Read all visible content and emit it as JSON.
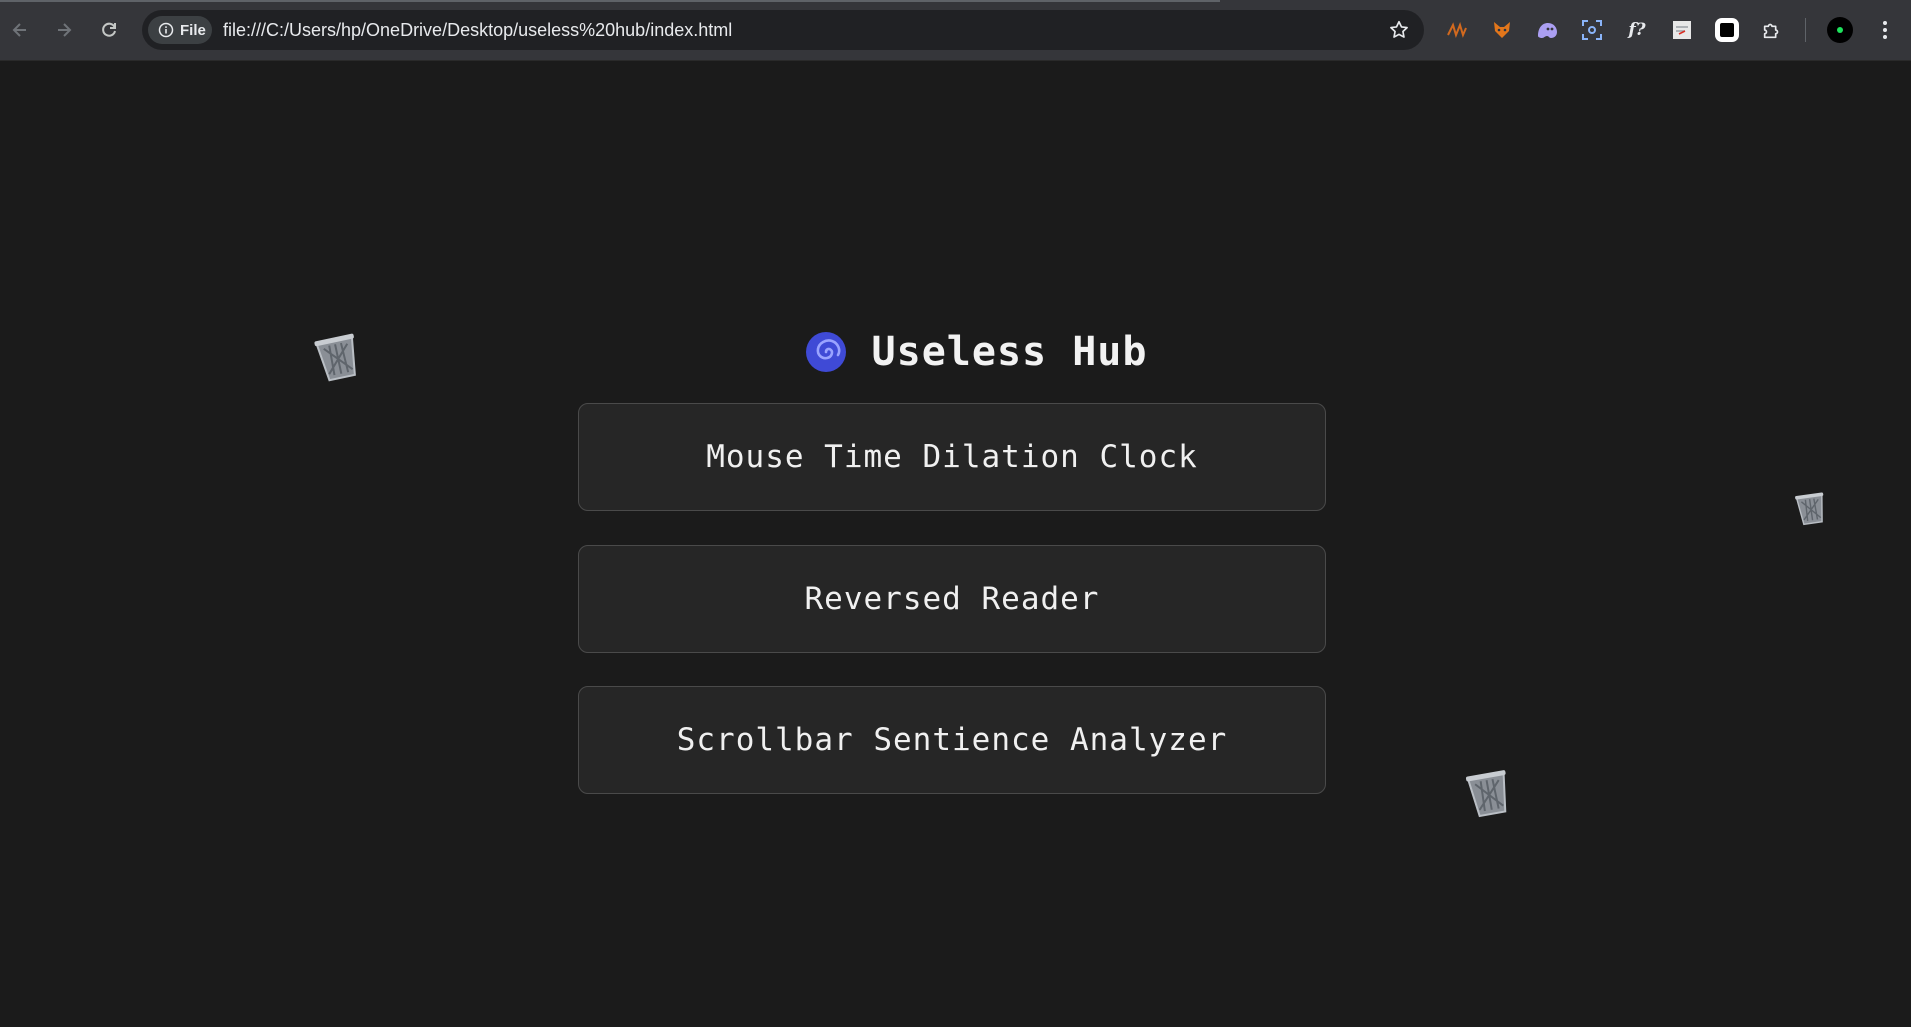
{
  "browser": {
    "site_chip": "File",
    "url": "file:///C:/Users/hp/OneDrive/Desktop/useless%20hub/index.html"
  },
  "page": {
    "title": "Useless Hub",
    "title_icon": "cyclone-icon",
    "tools": [
      {
        "label": "Mouse Time Dilation Clock"
      },
      {
        "label": "Reversed Reader"
      },
      {
        "label": "Scrollbar Sentience Analyzer"
      }
    ],
    "decorations": [
      "wastebasket-icon",
      "wastebasket-icon",
      "wastebasket-icon"
    ]
  },
  "colors": {
    "background": "#1b1b1b",
    "button_bg": "#262626",
    "button_border": "#4a4a4a",
    "text": "#f0f0f0",
    "cyclone": "#4b57e8"
  }
}
